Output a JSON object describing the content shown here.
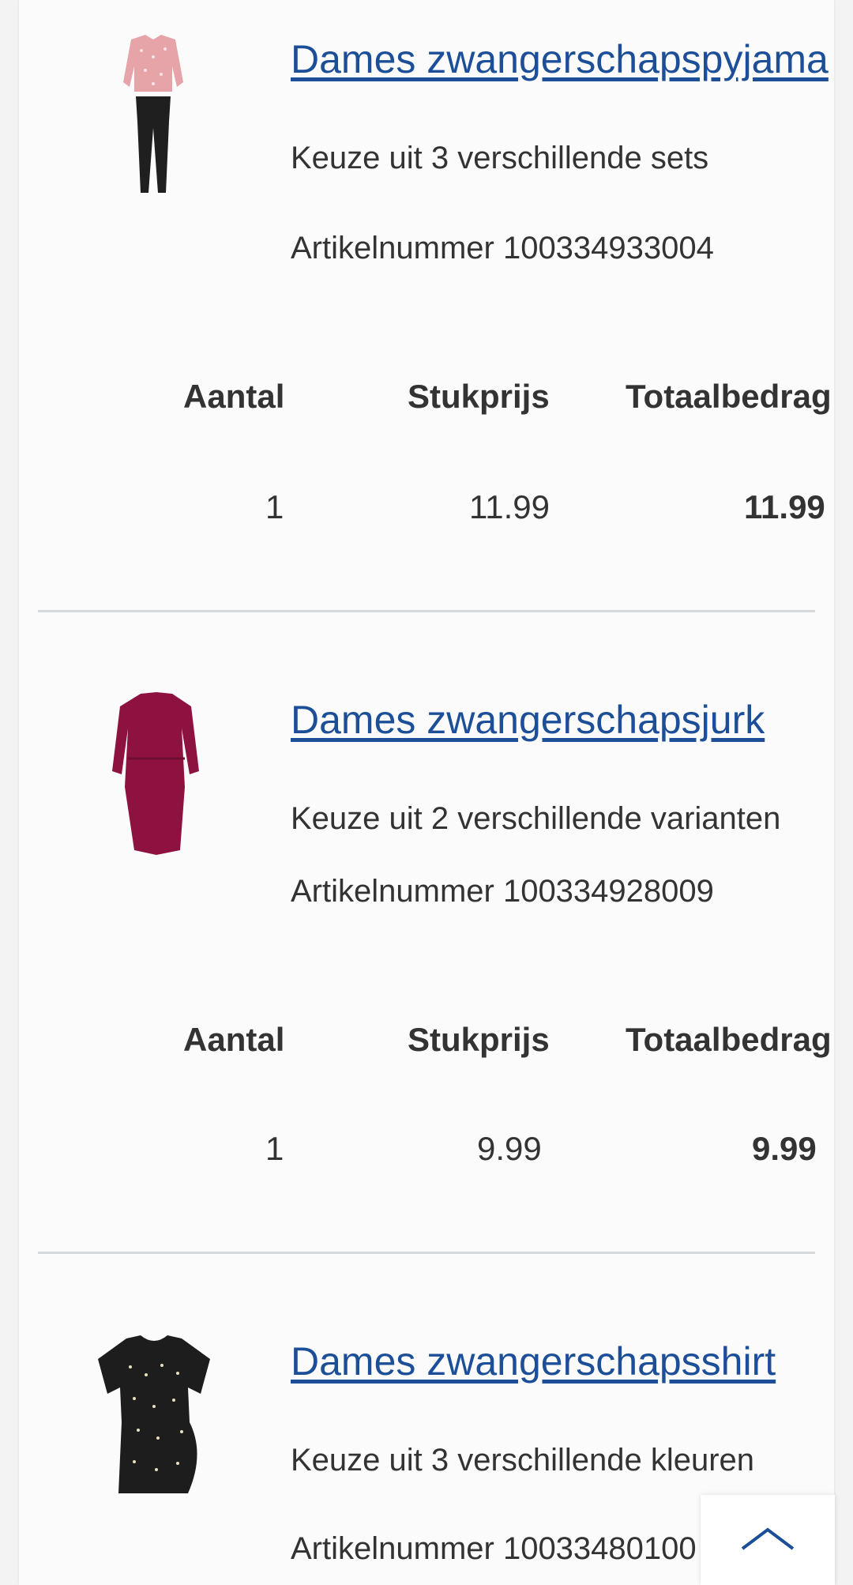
{
  "headers": {
    "quantity": "Aantal",
    "unit_price": "Stukprijs",
    "total": "Totaalbedrag"
  },
  "items": [
    {
      "name": "Dames zwangerschapspyjama",
      "variant_text": "Keuze uit 3 verschillende sets",
      "article_number": "Artikelnummer 100334933004",
      "quantity": "1",
      "unit_price": "11.99",
      "total": "11.99"
    },
    {
      "name": "Dames zwangerschapsjurk",
      "variant_text": "Keuze uit 2 verschillende varianten",
      "article_number": "Artikelnummer 100334928009",
      "quantity": "1",
      "unit_price": "9.99",
      "total": "9.99"
    },
    {
      "name": "Dames zwangerschapsshirt",
      "variant_text": "Keuze uit 3 verschillende kleuren",
      "article_number": "Artikelnummer 10033480100"
    }
  ],
  "icons": {
    "back_to_top": "chevron-up-icon"
  },
  "colors": {
    "link": "#1c4f97",
    "separator": "#d5d8dc",
    "dress": "#8e1240",
    "pyjama_top": "#e6a3a8"
  }
}
